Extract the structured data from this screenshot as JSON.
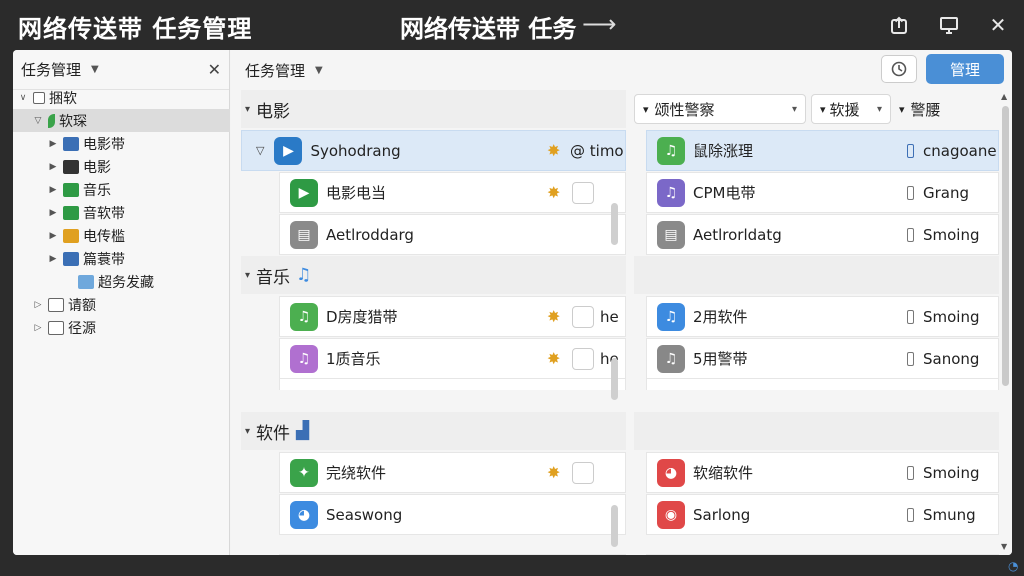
{
  "titlebar": {
    "title_left": "网络传送带 任务管理",
    "title_center": "网络传送带 任务",
    "arrow": "⟶",
    "btn_share_icon": "share-box-icon",
    "btn_monitor_icon": "monitor-icon",
    "btn_close": "✕"
  },
  "left_panel": {
    "title": "任务管理",
    "dropdown": "▼",
    "close": "✕",
    "tree": [
      {
        "label": "捆软",
        "twisty": "∨",
        "indent": 0,
        "icon": "checkbox-icon",
        "color": "#ffffff"
      },
      {
        "label": "软琛",
        "twisty": "▽",
        "indent": 1,
        "icon": "leaf-icon",
        "color": "#3aa34a",
        "selected": true
      },
      {
        "label": "电影带",
        "twisty": "▶",
        "indent": 2,
        "icon": "folder-icon",
        "color": "#3b6fb5"
      },
      {
        "label": "电影",
        "twisty": "▶",
        "indent": 2,
        "icon": "film-icon",
        "color": "#333333"
      },
      {
        "label": "音乐",
        "twisty": "▶",
        "indent": 2,
        "icon": "play-icon",
        "color": "#2e9a44"
      },
      {
        "label": "音软带",
        "twisty": "▶",
        "indent": 2,
        "icon": "play-icon",
        "color": "#2e9a44"
      },
      {
        "label": "电传槛",
        "twisty": "▶",
        "indent": 2,
        "icon": "folder-icon",
        "color": "#e0a020"
      },
      {
        "label": "篇蓑带",
        "twisty": "▶",
        "indent": 2,
        "icon": "folder-icon",
        "color": "#3b6fb5"
      },
      {
        "label": "超务发藏",
        "twisty": "",
        "indent": 3,
        "icon": "folder-icon",
        "color": "#6fa8dc"
      },
      {
        "label": "请额",
        "twisty": "▷",
        "indent": 1,
        "icon": "list-icon",
        "color": "#666666"
      },
      {
        "label": "径源",
        "twisty": "▷",
        "indent": 1,
        "icon": "folder-outline-icon",
        "color": "#666666"
      }
    ]
  },
  "right_panel": {
    "title": "任务管理",
    "dropdown": "▼",
    "history_icon": "history-icon",
    "manage_label": "管理",
    "filters": [
      {
        "label": "颂性警察",
        "caret": "▾",
        "prefix": "▾"
      },
      {
        "label": "软援",
        "caret": "▾",
        "prefix": "▾"
      },
      {
        "label": "警腰",
        "caret": "",
        "prefix": "▾"
      }
    ],
    "sections": [
      {
        "name": "电影",
        "caret": "▾",
        "icon": "",
        "rows": [
          {
            "left_label": "Syohodrang",
            "left_icon": "film-icon",
            "left_color": "#2a7ac7",
            "left_extra": "@ timo",
            "twisty": "▽",
            "highlight": true,
            "right_label": "鼠除涨理",
            "right_icon": "music-icon",
            "right_color": "#4caf50",
            "right_extra": "cnagoane"
          },
          {
            "left_label": "电影电当",
            "left_icon": "film-icon",
            "left_color": "#2e9a44",
            "left_extra": "",
            "twisty": "",
            "right_label": "CPM电带",
            "right_icon": "music-icon",
            "right_color": "#7b68c8",
            "right_extra": "Grang"
          },
          {
            "left_label": "Aetlroddarg",
            "left_icon": "installer-icon",
            "left_color": "#8a8a8a",
            "left_extra": "",
            "twisty": "",
            "right_label": "Aetlrorldatg",
            "right_icon": "installer-icon",
            "right_color": "#8a8a8a",
            "right_extra": "Smoing"
          }
        ]
      },
      {
        "name": "音乐",
        "caret": "▾",
        "icon": "♫",
        "rows": [
          {
            "left_label": "D房度猎带",
            "left_icon": "music-icon",
            "left_color": "#4caf50",
            "left_extra": "he",
            "twisty": "",
            "right_label": "2用软件",
            "right_icon": "music-icon",
            "right_color": "#3d8be0",
            "right_extra": "Smoing"
          },
          {
            "left_label": "1质音乐",
            "left_icon": "music-icon",
            "left_color": "#b070d0",
            "left_extra": "he",
            "twisty": "",
            "right_label": "5用警带",
            "right_icon": "music-icon",
            "right_color": "#888888",
            "right_extra": "Sanong"
          }
        ]
      },
      {
        "name": "软件",
        "caret": "▾",
        "icon": "▟",
        "rows": [
          {
            "left_label": "完绕软件",
            "left_icon": "app-icon",
            "left_color": "#3aa34a",
            "left_extra": "",
            "twisty": "",
            "right_label": "软缩软件",
            "right_icon": "colorwheel-icon",
            "right_color": "#e04848",
            "right_extra": "Smoing"
          },
          {
            "left_label": "Seaswong",
            "left_icon": "colorwheel-icon",
            "left_color": "#3d8be0",
            "left_extra": "",
            "twisty": "",
            "right_label": "Sarlong",
            "right_icon": "chrome-icon",
            "right_color": "#e04848",
            "right_extra": "Smung"
          }
        ]
      }
    ]
  }
}
